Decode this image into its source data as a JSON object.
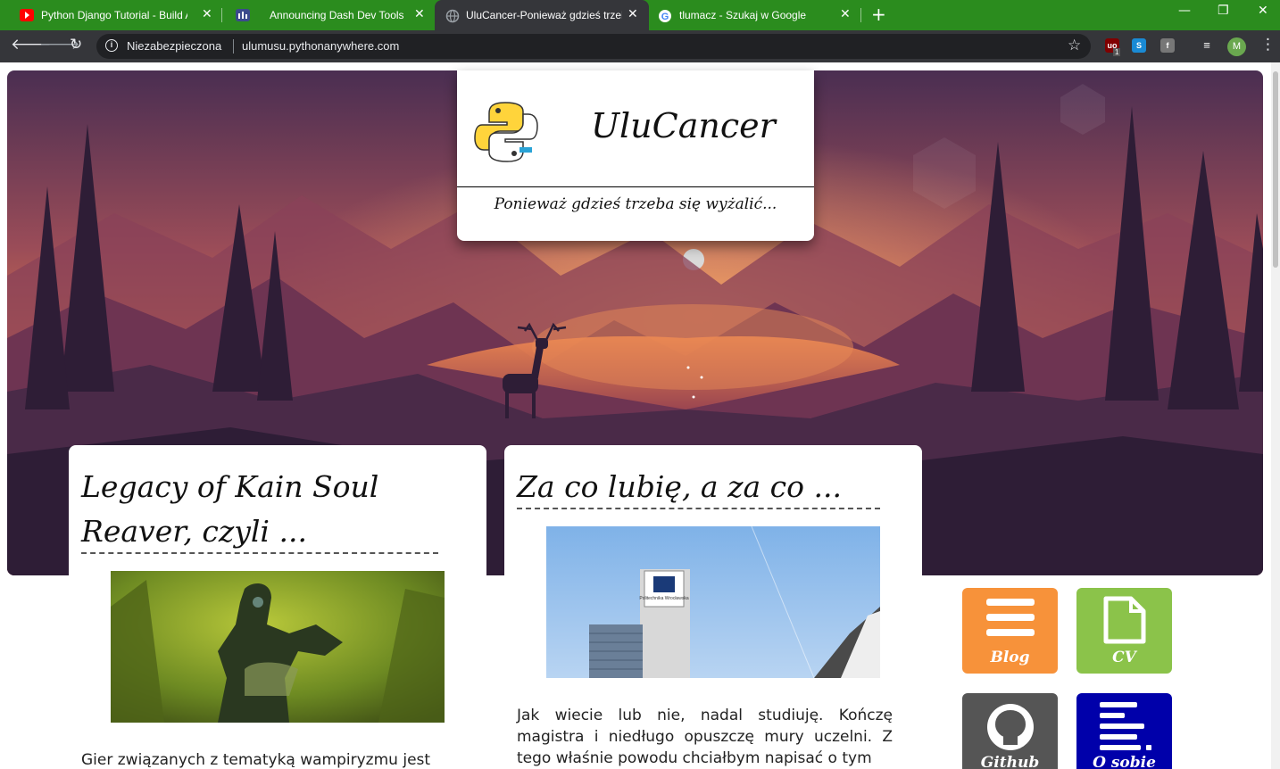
{
  "browser": {
    "tabs": [
      {
        "title": "Python Django Tutorial - Build A",
        "favicon": "youtube-icon",
        "active": false
      },
      {
        "title": "Announcing Dash Dev Tools",
        "favicon": "dash-icon",
        "active": false
      },
      {
        "title": "UluCancer-Ponieważ gdzieś trzeb",
        "favicon": "globe-icon",
        "active": true
      },
      {
        "title": "tlumacz - Szukaj w Google",
        "favicon": "google-icon",
        "active": false
      }
    ],
    "security_label": "Niezabezpieczona",
    "url": "ulumusu.pythonanywhere.com",
    "profile_initial": "M",
    "ext_badge": "1",
    "colors": {
      "tab_strip": "#2b8c1e",
      "toolbar": "#35363a",
      "omnibox": "#202124"
    }
  },
  "site": {
    "title": "UluCancer",
    "tagline": "Ponieważ gdzieś trzeba się wyżalić..."
  },
  "posts": [
    {
      "title": "Legacy of Kain Soul Reaver, czyli ...",
      "excerpt": "Gier związanych z tematyką wampiryzmu jest"
    },
    {
      "title": "Za co lubię, a za co ...",
      "excerpt": "Jak wiecie lub nie, nadal studiuję. Kończę magistra i niedługo opuszczę mury uczelni. Z tego właśnie powodu chciałbym napisać o tym",
      "image_sign": "Politechnika Wrocławska"
    }
  ],
  "nav_tiles": [
    {
      "label": "Blog",
      "icon": "menu-icon",
      "color": "#f7923a"
    },
    {
      "label": "CV",
      "icon": "document-icon",
      "color": "#8bc34a"
    },
    {
      "label": "Github",
      "icon": "github-icon",
      "color": "#555555"
    },
    {
      "label": "O sobie",
      "icon": "text-lines-icon",
      "color": "#0000aa"
    }
  ]
}
